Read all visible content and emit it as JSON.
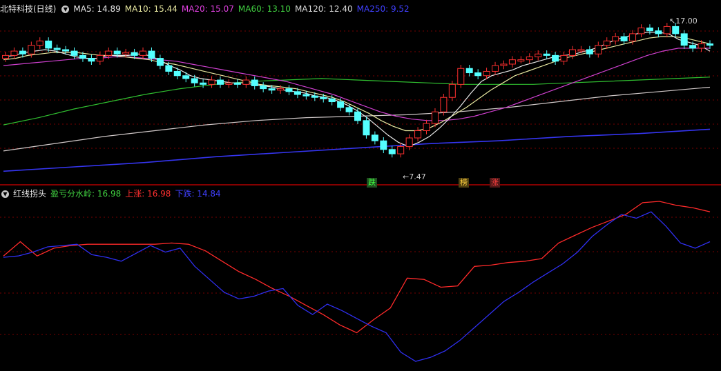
{
  "main_header": {
    "title": "北特科技(日线)",
    "ma_labels": [
      {
        "text": "MA5: 14.89",
        "color": "#e8e8e8"
      },
      {
        "text": "MA10: 15.44",
        "color": "#e8e8a0"
      },
      {
        "text": "MA20: 15.07",
        "color": "#e040e0"
      },
      {
        "text": "MA60: 13.10",
        "color": "#40d040"
      },
      {
        "text": "MA120: 12.40",
        "color": "#d8d8d8"
      },
      {
        "text": "MA250: 9.52",
        "color": "#4040ff"
      }
    ]
  },
  "sub_header": {
    "title": "红线拐头",
    "items": [
      {
        "text": "盈亏分水岭: 16.98",
        "color": "#40d040"
      },
      {
        "text": "上涨: 16.98",
        "color": "#ff3030"
      },
      {
        "text": "下跌: 14.84",
        "color": "#4040ff"
      }
    ]
  },
  "annotations": {
    "high": "17.00",
    "low": "7.47",
    "tags": [
      {
        "text": "跌",
        "color": "#40ff40",
        "bg": "#205020"
      },
      {
        "text": "榜",
        "color": "#ffd040",
        "bg": "#504010"
      },
      {
        "text": "涨",
        "color": "#ff4040",
        "bg": "#501818"
      }
    ]
  },
  "colors": {
    "up": "#ff3030",
    "down": "#54ffff",
    "grid": "#7a0000",
    "divider": "#b00000"
  },
  "chart_data": {
    "type": "line",
    "candles_close": [
      14.6,
      14.9,
      14.7,
      15.3,
      15.6,
      15.1,
      15.0,
      14.9,
      14.6,
      14.4,
      14.2,
      14.6,
      14.9,
      14.7,
      14.8,
      14.6,
      14.9,
      14.4,
      13.9,
      13.5,
      13.2,
      13.0,
      12.7,
      12.6,
      12.9,
      12.6,
      12.7,
      12.6,
      12.9,
      12.5,
      12.3,
      12.2,
      12.3,
      12.1,
      11.9,
      11.8,
      11.7,
      11.6,
      11.4,
      11.0,
      10.7,
      10.1,
      9.1,
      8.7,
      8.1,
      7.8,
      8.3,
      8.9,
      9.4,
      9.9,
      10.7,
      11.7,
      12.6,
      13.7,
      13.4,
      13.2,
      13.5,
      13.9,
      14.0,
      14.3,
      14.3,
      14.5,
      14.7,
      14.6,
      14.2,
      14.6,
      15.0,
      15.0,
      14.7,
      15.3,
      15.6,
      15.9,
      15.6,
      16.1,
      16.5,
      16.3,
      16.1,
      16.6,
      16.1,
      15.3,
      15.1,
      15.4,
      15.3
    ],
    "ma5": [
      14.5,
      14.6,
      14.8,
      14.9,
      15.0,
      14.9,
      14.7,
      14.5,
      14.4,
      14.4,
      14.6,
      14.6,
      14.6,
      14.7,
      14.6,
      14.3,
      13.9,
      13.6,
      13.2,
      13.0,
      12.9,
      12.8,
      12.7,
      12.7,
      12.6,
      12.5,
      12.4,
      12.2,
      12.1,
      12.0,
      11.8,
      11.7,
      11.5,
      11.2,
      10.8,
      10.3,
      9.7,
      9.1,
      8.6,
      8.3,
      8.6,
      9.0,
      9.6,
      10.3,
      11.1,
      12.0,
      12.8,
      13.2,
      13.4,
      13.6,
      13.9,
      14.1,
      14.3,
      14.5,
      14.6,
      14.7,
      14.9,
      15.1,
      15.4,
      15.7,
      15.9,
      16.1,
      16.2,
      16.2,
      16.1,
      15.7,
      15.5,
      15.3,
      14.9
    ],
    "ma10": [
      14.3,
      14.4,
      14.6,
      14.7,
      14.8,
      14.8,
      14.8,
      14.7,
      14.6,
      14.6,
      14.5,
      14.4,
      14.3,
      14.1,
      14.0,
      13.8,
      13.6,
      13.4,
      13.2,
      13.0,
      12.8,
      12.6,
      12.5,
      12.4,
      12.3,
      12.1,
      11.9,
      11.7,
      11.4,
      11.0,
      10.6,
      10.1,
      9.7,
      9.4,
      9.4,
      9.6,
      10.0,
      10.5,
      11.0,
      11.6,
      12.2,
      12.7,
      13.2,
      13.5,
      13.8,
      14.1,
      14.4,
      14.6,
      14.8,
      15.0,
      15.2,
      15.4,
      15.6,
      15.8,
      15.9,
      15.9,
      15.8,
      15.6,
      15.4
    ],
    "ma20": [
      13.9,
      14.0,
      14.1,
      14.2,
      14.3,
      14.4,
      14.4,
      14.5,
      14.5,
      14.4,
      14.3,
      14.2,
      14.0,
      13.8,
      13.6,
      13.4,
      13.2,
      13.0,
      12.8,
      12.5,
      12.2,
      11.9,
      11.5,
      11.1,
      10.7,
      10.4,
      10.2,
      10.1,
      10.1,
      10.2,
      10.4,
      10.7,
      11.0,
      11.4,
      11.8,
      12.2,
      12.6,
      13.0,
      13.4,
      13.8,
      14.2,
      14.6,
      14.9,
      15.1,
      15.1,
      15.1
    ],
    "ma60": [
      9.8,
      10.3,
      10.9,
      11.4,
      11.9,
      12.3,
      12.6,
      12.8,
      12.9,
      13.0,
      12.9,
      12.8,
      12.7,
      12.6,
      12.6,
      12.6,
      12.7,
      12.8,
      12.9,
      13.0,
      13.1
    ],
    "ma120": [
      8.0,
      8.5,
      9.0,
      9.4,
      9.8,
      10.1,
      10.3,
      10.4,
      10.5,
      10.7,
      11.0,
      11.4,
      11.8,
      12.1,
      12.4
    ],
    "ma250": [
      6.6,
      6.9,
      7.2,
      7.6,
      7.9,
      8.2,
      8.5,
      8.7,
      9.0,
      9.2,
      9.5
    ],
    "sub_red": [
      15.0,
      16.1,
      15.0,
      15.6,
      15.8,
      15.9,
      15.9,
      15.9,
      15.9,
      15.9,
      16.0,
      15.9,
      15.4,
      14.6,
      13.8,
      13.2,
      12.5,
      11.9,
      11.2,
      10.5,
      9.7,
      9.1,
      10.1,
      11.0,
      13.3,
      13.2,
      12.6,
      12.7,
      14.2,
      14.3,
      14.5,
      14.6,
      14.8,
      16.0,
      16.6,
      17.2,
      17.7,
      18.2,
      19.1,
      19.2,
      18.9,
      18.7,
      18.4
    ],
    "sub_blue": [
      14.9,
      15.0,
      15.3,
      15.7,
      15.8,
      15.9,
      15.1,
      14.9,
      14.6,
      15.2,
      15.8,
      15.3,
      15.6,
      14.2,
      13.2,
      12.2,
      11.7,
      11.9,
      12.3,
      12.5,
      11.2,
      10.5,
      11.3,
      10.8,
      10.2,
      9.6,
      9.1,
      7.6,
      6.9,
      7.2,
      7.7,
      8.5,
      9.5,
      10.5,
      11.5,
      12.2,
      13.0,
      13.7,
      14.4,
      15.3,
      16.5,
      17.4,
      18.2,
      17.9,
      18.4,
      17.3,
      16.0,
      15.6,
      16.1
    ]
  }
}
